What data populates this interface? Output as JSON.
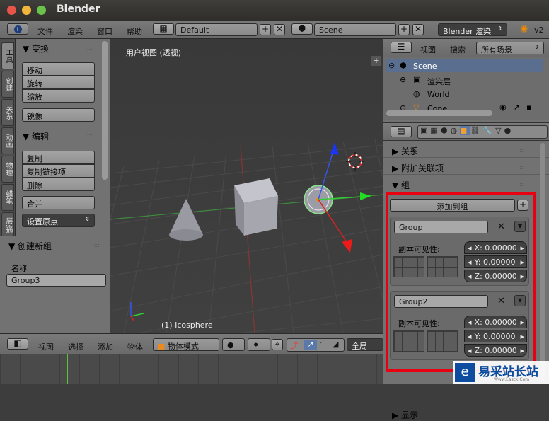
{
  "window": {
    "title": "Blender"
  },
  "menubar": {
    "menus": [
      "文件",
      "渲染",
      "窗口",
      "帮助"
    ],
    "layout": "Default",
    "scene": "Scene",
    "engine": "Blender 渲染",
    "version": "v2"
  },
  "toolshelf": {
    "tabs": [
      "工具",
      "创建",
      "关系",
      "动画",
      "物理",
      "蜡笔",
      "层:通"
    ],
    "transform_header": "变换",
    "move": "移动",
    "rotate": "旋转",
    "scale": "缩放",
    "mirror": "镜像",
    "edit_header": "编辑",
    "duplicate": "复制",
    "duplicate_linked": "复制链接项",
    "delete": "删除",
    "join": "合并",
    "set_origin": "设置原点"
  },
  "operator": {
    "header": "创建新组",
    "name_label": "名称",
    "name_value": "Group3"
  },
  "viewport": {
    "label": "用户视图 (透视)",
    "active_object": "(1) Icosphere"
  },
  "footer": {
    "view": "视图",
    "select": "选择",
    "add": "添加",
    "object": "物体",
    "mode": "物体模式",
    "global": "全局"
  },
  "outliner": {
    "view": "视图",
    "search": "搜索",
    "filter": "所有场景",
    "items": [
      "Scene",
      "渲染层",
      "World",
      "Cone"
    ]
  },
  "properties": {
    "relations": "关系",
    "relations_extras": "附加关联项",
    "groups_header": "组",
    "add_to_group": "添加到组",
    "groups": [
      {
        "name": "Group",
        "dupli_label": "副本可见性:",
        "x": "X:  0.00000",
        "y": "Y:  0.00000",
        "z": "Z:  0.00000"
      },
      {
        "name": "Group2",
        "dupli_label": "副本可见性:",
        "x": "X:  0.00000",
        "y": "Y:  0.00000",
        "z": "Z:  0.00000"
      }
    ],
    "display": "显示"
  },
  "watermark": {
    "text": "易采站长站",
    "sub": "Www.Easck.Com"
  },
  "colors": {
    "highlight": "#e60012",
    "accent_blue": "#0d4c9e"
  }
}
